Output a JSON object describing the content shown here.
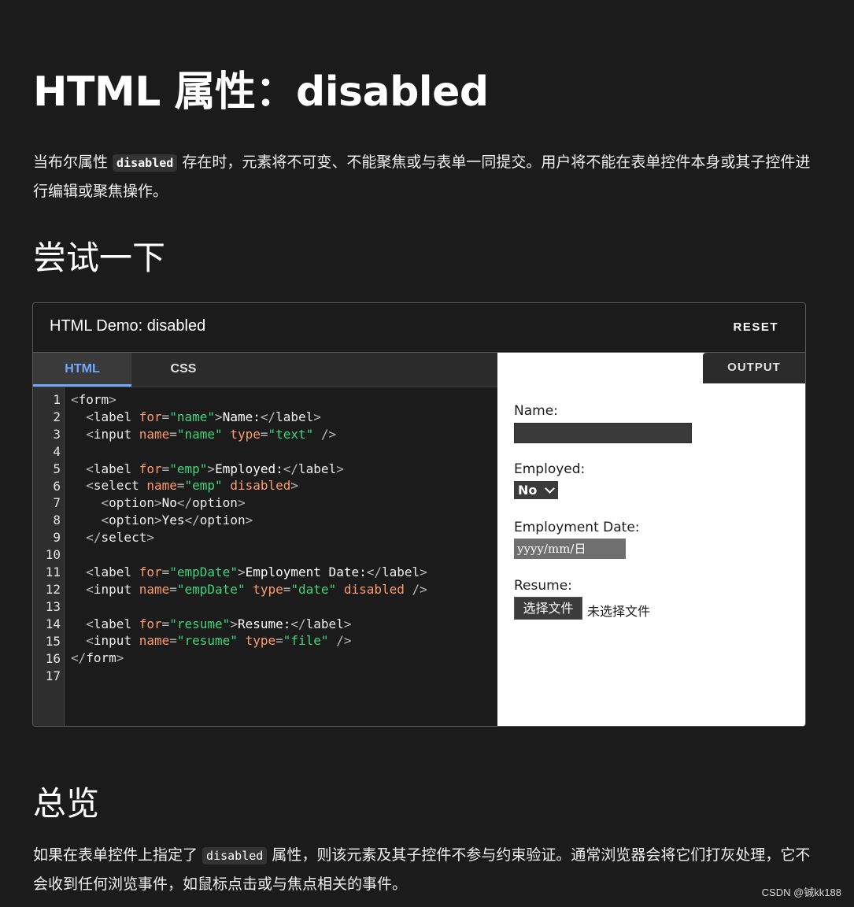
{
  "page": {
    "title": "HTML 属性：disabled",
    "intro": {
      "before": "当布尔属性 ",
      "code": "disabled",
      "after": " 存在时，元素将不可变、不能聚焦或与表单一同提交。用户将不能在表单控件本身或其子控件进行编辑或聚焦操作。"
    },
    "try_heading": "尝试一下",
    "overview_heading": "总览",
    "overview": {
      "before": "如果在表单控件上指定了 ",
      "code": "disabled",
      "after": " 属性，则该元素及其子控件不参与约束验证。通常浏览器会将它们打灰处理，它不会收到任何浏览事件，如鼠标点击或与焦点相关的事件。"
    },
    "watermark": "CSDN @铖kk188"
  },
  "demo": {
    "title": "HTML Demo: disabled",
    "reset_label": "RESET",
    "tabs": [
      {
        "label": "HTML",
        "active": true
      },
      {
        "label": "CSS",
        "active": false
      }
    ],
    "output_tab_label": "OUTPUT",
    "line_numbers": "1\n2\n3\n4\n5\n6\n7\n8\n9\n10\n11\n12\n13\n14\n15\n16\n17",
    "code_lines": [
      [
        [
          "p",
          "<"
        ],
        [
          "t",
          "form"
        ],
        [
          "p",
          ">"
        ]
      ],
      [
        [
          "x",
          "  "
        ],
        [
          "p",
          "<"
        ],
        [
          "t",
          "label "
        ],
        [
          "a",
          "for"
        ],
        [
          "p",
          "="
        ],
        [
          "s",
          "\"name\""
        ],
        [
          "p",
          ">"
        ],
        [
          "x",
          "Name:"
        ],
        [
          "p",
          "</"
        ],
        [
          "t",
          "label"
        ],
        [
          "p",
          ">"
        ]
      ],
      [
        [
          "x",
          "  "
        ],
        [
          "p",
          "<"
        ],
        [
          "t",
          "input "
        ],
        [
          "a",
          "name"
        ],
        [
          "p",
          "="
        ],
        [
          "s",
          "\"name\" "
        ],
        [
          "a",
          "type"
        ],
        [
          "p",
          "="
        ],
        [
          "s",
          "\"text\" "
        ],
        [
          "p",
          "/>"
        ]
      ],
      [],
      [
        [
          "x",
          "  "
        ],
        [
          "p",
          "<"
        ],
        [
          "t",
          "label "
        ],
        [
          "a",
          "for"
        ],
        [
          "p",
          "="
        ],
        [
          "s",
          "\"emp\""
        ],
        [
          "p",
          ">"
        ],
        [
          "x",
          "Employed:"
        ],
        [
          "p",
          "</"
        ],
        [
          "t",
          "label"
        ],
        [
          "p",
          ">"
        ]
      ],
      [
        [
          "x",
          "  "
        ],
        [
          "p",
          "<"
        ],
        [
          "t",
          "select "
        ],
        [
          "a",
          "name"
        ],
        [
          "p",
          "="
        ],
        [
          "s",
          "\"emp\" "
        ],
        [
          "a",
          "disabled"
        ],
        [
          "p",
          ">"
        ]
      ],
      [
        [
          "x",
          "    "
        ],
        [
          "p",
          "<"
        ],
        [
          "t",
          "option"
        ],
        [
          "p",
          ">"
        ],
        [
          "x",
          "No"
        ],
        [
          "p",
          "</"
        ],
        [
          "t",
          "option"
        ],
        [
          "p",
          ">"
        ]
      ],
      [
        [
          "x",
          "    "
        ],
        [
          "p",
          "<"
        ],
        [
          "t",
          "option"
        ],
        [
          "p",
          ">"
        ],
        [
          "x",
          "Yes"
        ],
        [
          "p",
          "</"
        ],
        [
          "t",
          "option"
        ],
        [
          "p",
          ">"
        ]
      ],
      [
        [
          "x",
          "  "
        ],
        [
          "p",
          "</"
        ],
        [
          "t",
          "select"
        ],
        [
          "p",
          ">"
        ]
      ],
      [],
      [
        [
          "x",
          "  "
        ],
        [
          "p",
          "<"
        ],
        [
          "t",
          "label "
        ],
        [
          "a",
          "for"
        ],
        [
          "p",
          "="
        ],
        [
          "s",
          "\"empDate\""
        ],
        [
          "p",
          ">"
        ],
        [
          "x",
          "Employment Date:"
        ],
        [
          "p",
          "</"
        ],
        [
          "t",
          "label"
        ],
        [
          "p",
          ">"
        ]
      ],
      [
        [
          "x",
          "  "
        ],
        [
          "p",
          "<"
        ],
        [
          "t",
          "input "
        ],
        [
          "a",
          "name"
        ],
        [
          "p",
          "="
        ],
        [
          "s",
          "\"empDate\" "
        ],
        [
          "a",
          "type"
        ],
        [
          "p",
          "="
        ],
        [
          "s",
          "\"date\" "
        ],
        [
          "a",
          "disabled "
        ],
        [
          "p",
          "/>"
        ]
      ],
      [],
      [
        [
          "x",
          "  "
        ],
        [
          "p",
          "<"
        ],
        [
          "t",
          "label "
        ],
        [
          "a",
          "for"
        ],
        [
          "p",
          "="
        ],
        [
          "s",
          "\"resume\""
        ],
        [
          "p",
          ">"
        ],
        [
          "x",
          "Resume:"
        ],
        [
          "p",
          "</"
        ],
        [
          "t",
          "label"
        ],
        [
          "p",
          ">"
        ]
      ],
      [
        [
          "x",
          "  "
        ],
        [
          "p",
          "<"
        ],
        [
          "t",
          "input "
        ],
        [
          "a",
          "name"
        ],
        [
          "p",
          "="
        ],
        [
          "s",
          "\"resume\" "
        ],
        [
          "a",
          "type"
        ],
        [
          "p",
          "="
        ],
        [
          "s",
          "\"file\" "
        ],
        [
          "p",
          "/>"
        ]
      ],
      [
        [
          "p",
          "</"
        ],
        [
          "t",
          "form"
        ],
        [
          "p",
          ">"
        ]
      ],
      []
    ],
    "output": {
      "name_label": "Name:",
      "employed_label": "Employed:",
      "employed_selected": "No",
      "date_label": "Employment Date:",
      "date_placeholder": "yyyy/mm/日",
      "resume_label": "Resume:",
      "file_button_label": "选择文件",
      "file_status": "未选择文件"
    }
  }
}
